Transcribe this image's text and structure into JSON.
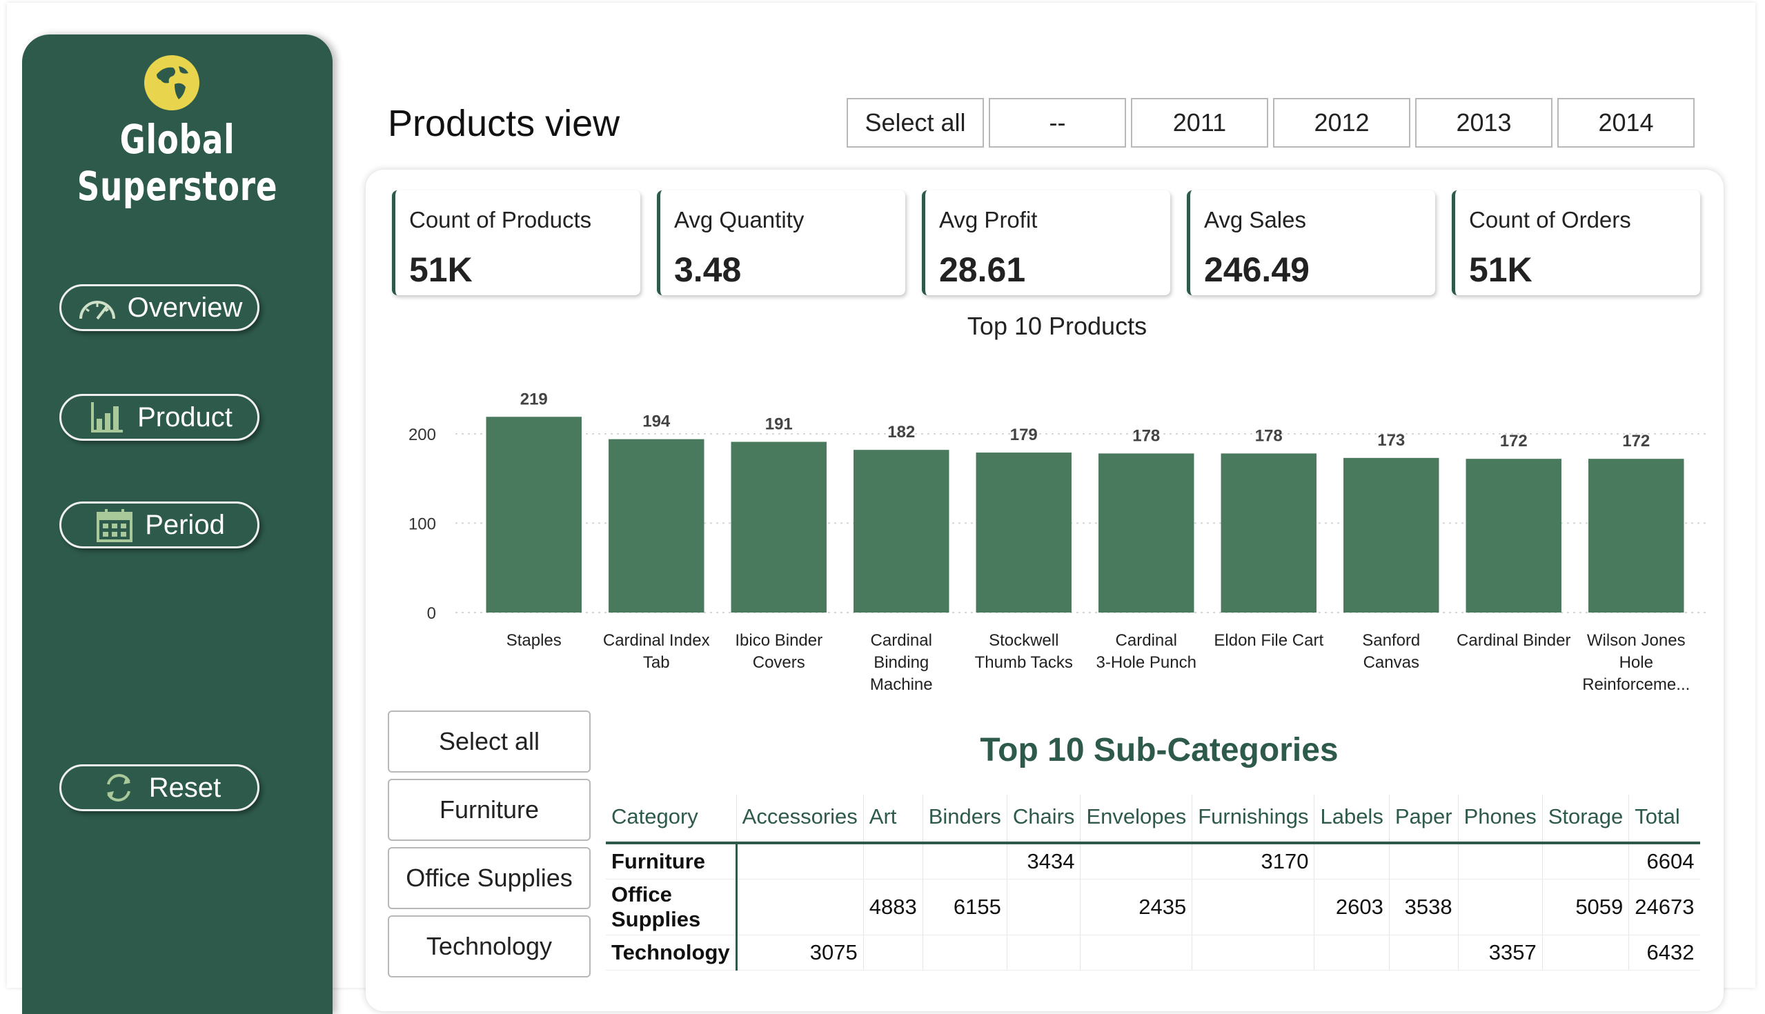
{
  "sidebar": {
    "brand": "Global Superstore",
    "nav": {
      "overview": "Overview",
      "product": "Product",
      "period": "Period",
      "reset": "Reset"
    }
  },
  "header": {
    "title": "Products view",
    "years": [
      "Select all",
      "--",
      "2011",
      "2012",
      "2013",
      "2014"
    ]
  },
  "kpis": [
    {
      "label": "Count of Products",
      "value": "51K"
    },
    {
      "label": "Avg Quantity",
      "value": "3.48"
    },
    {
      "label": "Avg Profit",
      "value": "28.61"
    },
    {
      "label": "Avg Sales",
      "value": "246.49"
    },
    {
      "label": "Count of Orders",
      "value": "51K"
    }
  ],
  "chart_data": {
    "type": "bar",
    "title": "Top 10 Products",
    "categories": [
      [
        "Staples"
      ],
      [
        "Cardinal Index",
        "Tab"
      ],
      [
        "Ibico Binder",
        "Covers"
      ],
      [
        "Cardinal",
        "Binding",
        "Machine"
      ],
      [
        "Stockwell",
        "Thumb Tacks"
      ],
      [
        "Cardinal",
        "3-Hole Punch"
      ],
      [
        "Eldon File Cart"
      ],
      [
        "Sanford",
        "Canvas"
      ],
      [
        "Cardinal Binder"
      ],
      [
        "Wilson Jones",
        "Hole",
        "Reinforceme..."
      ]
    ],
    "values": [
      219,
      194,
      191,
      182,
      179,
      178,
      178,
      173,
      172,
      172
    ],
    "yticks": [
      0,
      100,
      200
    ],
    "ylim": [
      0,
      230
    ],
    "grid": true,
    "bar_color": "#4a7a5e"
  },
  "category_slicer": [
    "Select all",
    "Furniture",
    "Office Supplies",
    "Technology"
  ],
  "matrix": {
    "title": "Top 10 Sub-Categories",
    "columns": [
      "Category",
      "Accessories",
      "Art",
      "Binders",
      "Chairs",
      "Envelopes",
      "Furnishings",
      "Labels",
      "Paper",
      "Phones",
      "Storage",
      "Total"
    ],
    "rows": [
      [
        "Furniture",
        "",
        "",
        "",
        "3434",
        "",
        "3170",
        "",
        "",
        "",
        "",
        "6604"
      ],
      [
        "Office Supplies",
        "",
        "4883",
        "6155",
        "",
        "2435",
        "",
        "2603",
        "3538",
        "",
        "5059",
        "24673"
      ],
      [
        "Technology",
        "3075",
        "",
        "",
        "",
        "",
        "",
        "",
        "",
        "3357",
        "",
        "6432"
      ]
    ]
  },
  "colors": {
    "sidebar": "#2d5a4a",
    "accent": "#2d5a4a",
    "logo": "#e8d44d"
  }
}
